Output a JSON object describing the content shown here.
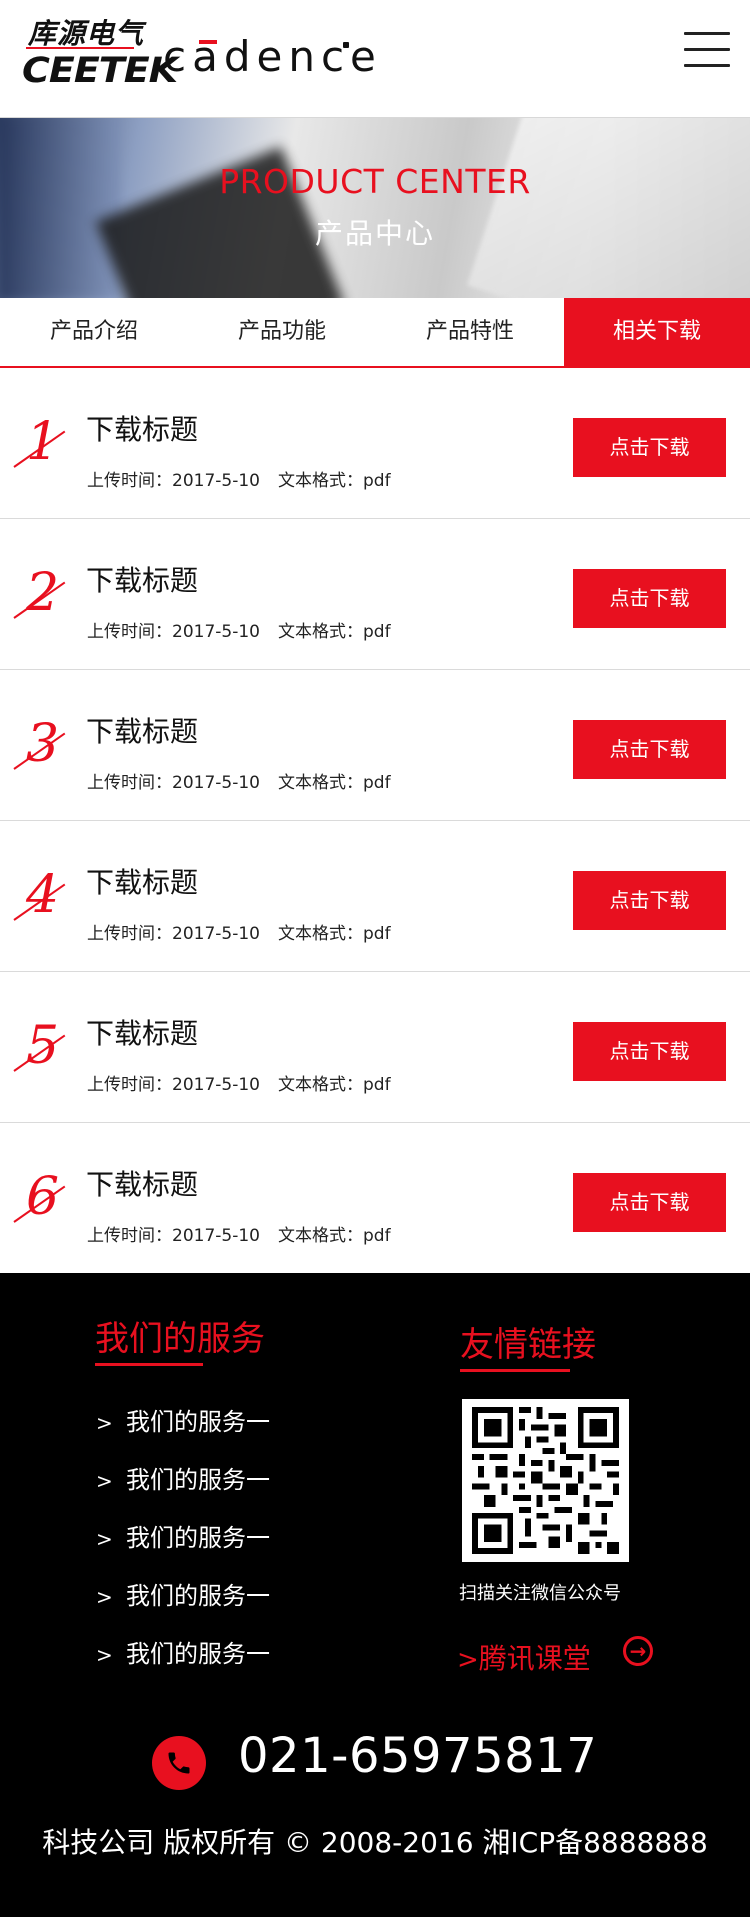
{
  "header": {
    "logo_cn": "库源电气",
    "logo_en": "CEETEK",
    "partner_logo": "cadence",
    "menu_icon": "hamburger-menu-icon"
  },
  "banner": {
    "title_en": "PRODUCT CENTER",
    "title_cn": "产品中心"
  },
  "tabs": [
    {
      "label": "产品介绍",
      "active": false
    },
    {
      "label": "产品功能",
      "active": false
    },
    {
      "label": "产品特性",
      "active": false
    },
    {
      "label": "相关下载",
      "active": true
    }
  ],
  "downloads": [
    {
      "num": "1",
      "title": "下载标题",
      "upload": "上传时间：2017-5-10",
      "format": "文本格式：pdf",
      "button": "点击下载"
    },
    {
      "num": "2",
      "title": "下载标题",
      "upload": "上传时间：2017-5-10",
      "format": "文本格式：pdf",
      "button": "点击下载"
    },
    {
      "num": "3",
      "title": "下载标题",
      "upload": "上传时间：2017-5-10",
      "format": "文本格式：pdf",
      "button": "点击下载"
    },
    {
      "num": "4",
      "title": "下载标题",
      "upload": "上传时间：2017-5-10",
      "format": "文本格式：pdf",
      "button": "点击下载"
    },
    {
      "num": "5",
      "title": "下载标题",
      "upload": "上传时间：2017-5-10",
      "format": "文本格式：pdf",
      "button": "点击下载"
    },
    {
      "num": "6",
      "title": "下载标题",
      "upload": "上传时间：2017-5-10",
      "format": "文本格式：pdf",
      "button": "点击下载"
    }
  ],
  "footer": {
    "services_title": "我们的服务",
    "services": [
      "我们的服务一",
      "我们的服务一",
      "我们的服务一",
      "我们的服务一",
      "我们的服务一"
    ],
    "links_title": "友情链接",
    "qr_caption": "扫描关注微信公众号",
    "tencent_link": "腾讯课堂",
    "phone": "021-65975817",
    "copyright": "科技公司 版权所有 © 2008-2016 湘ICP备8888888"
  },
  "colors": {
    "accent": "#e8101f",
    "footer_bg": "#000000"
  }
}
